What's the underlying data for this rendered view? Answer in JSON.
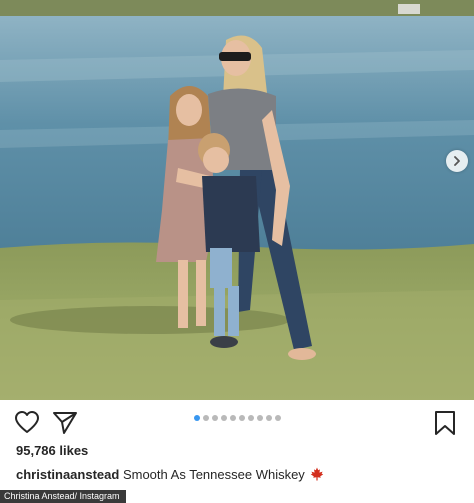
{
  "post": {
    "likes": "95,786 likes",
    "username": "christinaanstead",
    "caption": "Smooth As Tennessee Whiskey",
    "caption_emoji": "maple-leaf-icon",
    "carousel": {
      "total": 10,
      "current": 1
    },
    "colors": {
      "active_dot": "#3897f0",
      "inactive_dot": "#b9b9b9",
      "text": "#262626"
    }
  },
  "photo": {
    "subject": "woman with two children standing on grass by a lake"
  },
  "credit": "Christina Anstead/ Instagram"
}
